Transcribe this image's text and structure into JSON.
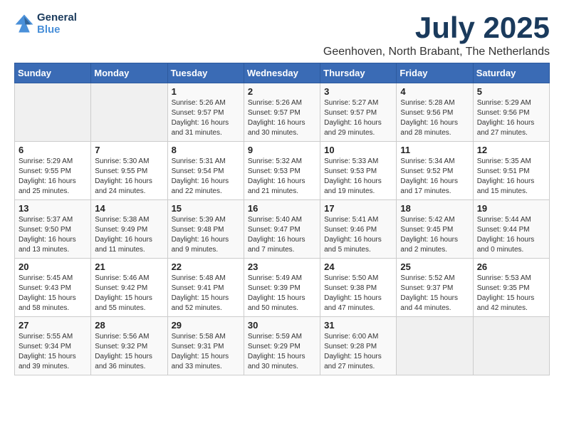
{
  "logo": {
    "line1": "General",
    "line2": "Blue"
  },
  "title": "July 2025",
  "location": "Geenhoven, North Brabant, The Netherlands",
  "days_of_week": [
    "Sunday",
    "Monday",
    "Tuesday",
    "Wednesday",
    "Thursday",
    "Friday",
    "Saturday"
  ],
  "weeks": [
    [
      {
        "day": "",
        "content": ""
      },
      {
        "day": "",
        "content": ""
      },
      {
        "day": "1",
        "content": "Sunrise: 5:26 AM\nSunset: 9:57 PM\nDaylight: 16 hours and 31 minutes."
      },
      {
        "day": "2",
        "content": "Sunrise: 5:26 AM\nSunset: 9:57 PM\nDaylight: 16 hours and 30 minutes."
      },
      {
        "day": "3",
        "content": "Sunrise: 5:27 AM\nSunset: 9:57 PM\nDaylight: 16 hours and 29 minutes."
      },
      {
        "day": "4",
        "content": "Sunrise: 5:28 AM\nSunset: 9:56 PM\nDaylight: 16 hours and 28 minutes."
      },
      {
        "day": "5",
        "content": "Sunrise: 5:29 AM\nSunset: 9:56 PM\nDaylight: 16 hours and 27 minutes."
      }
    ],
    [
      {
        "day": "6",
        "content": "Sunrise: 5:29 AM\nSunset: 9:55 PM\nDaylight: 16 hours and 25 minutes."
      },
      {
        "day": "7",
        "content": "Sunrise: 5:30 AM\nSunset: 9:55 PM\nDaylight: 16 hours and 24 minutes."
      },
      {
        "day": "8",
        "content": "Sunrise: 5:31 AM\nSunset: 9:54 PM\nDaylight: 16 hours and 22 minutes."
      },
      {
        "day": "9",
        "content": "Sunrise: 5:32 AM\nSunset: 9:53 PM\nDaylight: 16 hours and 21 minutes."
      },
      {
        "day": "10",
        "content": "Sunrise: 5:33 AM\nSunset: 9:53 PM\nDaylight: 16 hours and 19 minutes."
      },
      {
        "day": "11",
        "content": "Sunrise: 5:34 AM\nSunset: 9:52 PM\nDaylight: 16 hours and 17 minutes."
      },
      {
        "day": "12",
        "content": "Sunrise: 5:35 AM\nSunset: 9:51 PM\nDaylight: 16 hours and 15 minutes."
      }
    ],
    [
      {
        "day": "13",
        "content": "Sunrise: 5:37 AM\nSunset: 9:50 PM\nDaylight: 16 hours and 13 minutes."
      },
      {
        "day": "14",
        "content": "Sunrise: 5:38 AM\nSunset: 9:49 PM\nDaylight: 16 hours and 11 minutes."
      },
      {
        "day": "15",
        "content": "Sunrise: 5:39 AM\nSunset: 9:48 PM\nDaylight: 16 hours and 9 minutes."
      },
      {
        "day": "16",
        "content": "Sunrise: 5:40 AM\nSunset: 9:47 PM\nDaylight: 16 hours and 7 minutes."
      },
      {
        "day": "17",
        "content": "Sunrise: 5:41 AM\nSunset: 9:46 PM\nDaylight: 16 hours and 5 minutes."
      },
      {
        "day": "18",
        "content": "Sunrise: 5:42 AM\nSunset: 9:45 PM\nDaylight: 16 hours and 2 minutes."
      },
      {
        "day": "19",
        "content": "Sunrise: 5:44 AM\nSunset: 9:44 PM\nDaylight: 16 hours and 0 minutes."
      }
    ],
    [
      {
        "day": "20",
        "content": "Sunrise: 5:45 AM\nSunset: 9:43 PM\nDaylight: 15 hours and 58 minutes."
      },
      {
        "day": "21",
        "content": "Sunrise: 5:46 AM\nSunset: 9:42 PM\nDaylight: 15 hours and 55 minutes."
      },
      {
        "day": "22",
        "content": "Sunrise: 5:48 AM\nSunset: 9:41 PM\nDaylight: 15 hours and 52 minutes."
      },
      {
        "day": "23",
        "content": "Sunrise: 5:49 AM\nSunset: 9:39 PM\nDaylight: 15 hours and 50 minutes."
      },
      {
        "day": "24",
        "content": "Sunrise: 5:50 AM\nSunset: 9:38 PM\nDaylight: 15 hours and 47 minutes."
      },
      {
        "day": "25",
        "content": "Sunrise: 5:52 AM\nSunset: 9:37 PM\nDaylight: 15 hours and 44 minutes."
      },
      {
        "day": "26",
        "content": "Sunrise: 5:53 AM\nSunset: 9:35 PM\nDaylight: 15 hours and 42 minutes."
      }
    ],
    [
      {
        "day": "27",
        "content": "Sunrise: 5:55 AM\nSunset: 9:34 PM\nDaylight: 15 hours and 39 minutes."
      },
      {
        "day": "28",
        "content": "Sunrise: 5:56 AM\nSunset: 9:32 PM\nDaylight: 15 hours and 36 minutes."
      },
      {
        "day": "29",
        "content": "Sunrise: 5:58 AM\nSunset: 9:31 PM\nDaylight: 15 hours and 33 minutes."
      },
      {
        "day": "30",
        "content": "Sunrise: 5:59 AM\nSunset: 9:29 PM\nDaylight: 15 hours and 30 minutes."
      },
      {
        "day": "31",
        "content": "Sunrise: 6:00 AM\nSunset: 9:28 PM\nDaylight: 15 hours and 27 minutes."
      },
      {
        "day": "",
        "content": ""
      },
      {
        "day": "",
        "content": ""
      }
    ]
  ]
}
